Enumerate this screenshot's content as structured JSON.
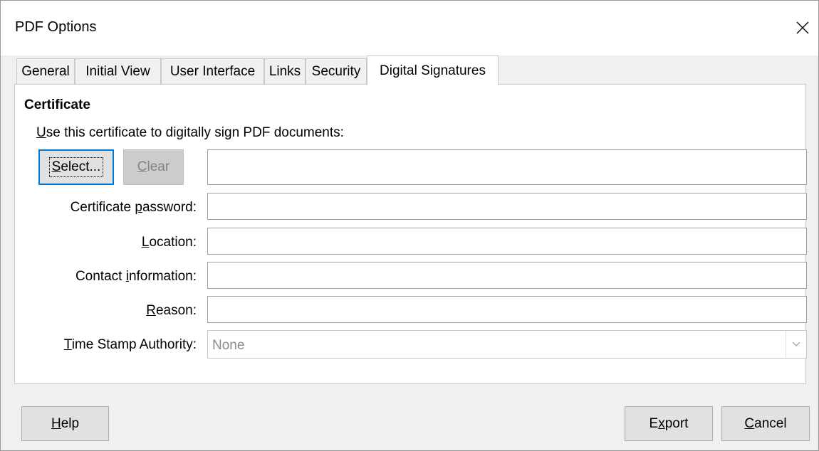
{
  "window": {
    "title": "PDF Options"
  },
  "tabs": [
    {
      "label": "General"
    },
    {
      "label": "Initial View"
    },
    {
      "label": "User Interface"
    },
    {
      "label": "Links"
    },
    {
      "label": "Security"
    },
    {
      "label": "Digital Signatures",
      "active": true
    }
  ],
  "certificate": {
    "heading": "Certificate",
    "intro_first": "U",
    "intro_rest": "se this certificate to digitally sign PDF documents:",
    "select_first": "S",
    "select_rest": "elect...",
    "clear_first": "C",
    "clear_rest": "lear",
    "certificate_value": ""
  },
  "fields": {
    "password": {
      "pre": "Certificate ",
      "mnemonic": "p",
      "post": "assword:",
      "value": ""
    },
    "location": {
      "pre": "",
      "mnemonic": "L",
      "post": "ocation:",
      "value": ""
    },
    "contact": {
      "pre": "Contact ",
      "mnemonic": "i",
      "post": "nformation:",
      "value": ""
    },
    "reason": {
      "pre": "",
      "mnemonic": "R",
      "post": "eason:",
      "value": ""
    },
    "tsa": {
      "pre": "",
      "mnemonic": "T",
      "post": "ime Stamp Authority:",
      "value": "None"
    }
  },
  "buttons": {
    "help_first": "H",
    "help_rest": "elp",
    "export_pre": "E",
    "export_mn": "x",
    "export_post": "port",
    "cancel_first": "C",
    "cancel_rest": "ancel"
  }
}
